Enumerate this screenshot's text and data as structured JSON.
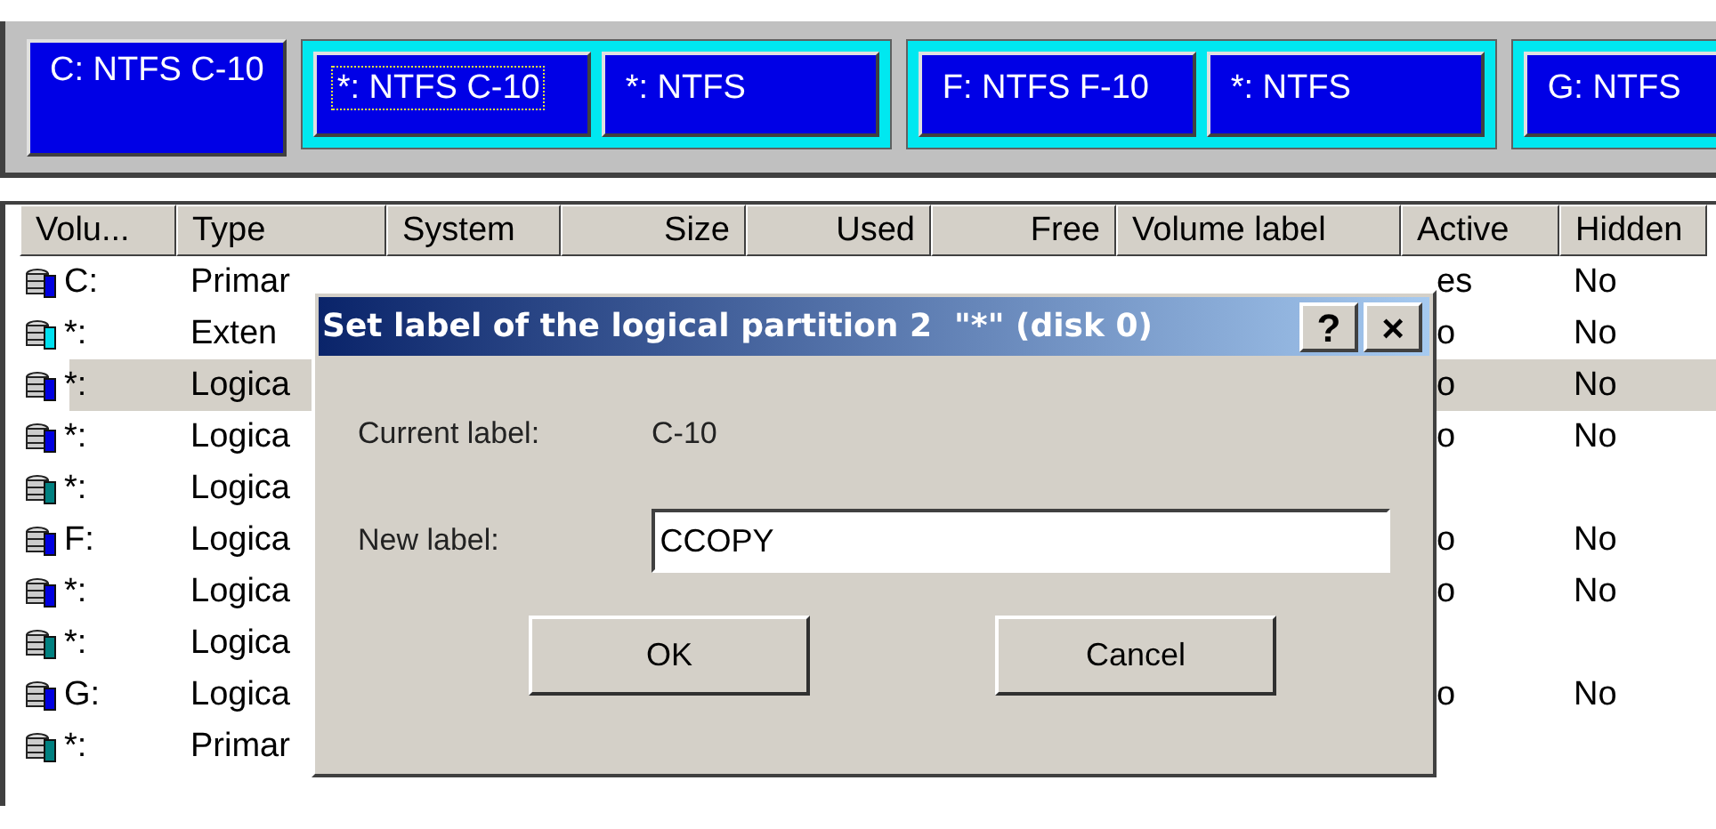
{
  "disk_map": {
    "partitions": [
      {
        "kind": "primary",
        "label": "C: NTFS C-10",
        "focused": false
      },
      {
        "kind": "extended",
        "children": [
          {
            "label": "*: NTFS C-10",
            "focused": true
          },
          {
            "label": "*: NTFS",
            "focused": false
          }
        ]
      },
      {
        "kind": "extended",
        "children": [
          {
            "label": "F: NTFS F-10",
            "focused": false
          },
          {
            "label": "*: NTFS",
            "focused": false
          }
        ]
      },
      {
        "kind": "extended",
        "children": [
          {
            "label": "G: NTFS",
            "focused": false
          }
        ]
      }
    ]
  },
  "table": {
    "columns": [
      "Volu...",
      "Type",
      "System",
      "Size",
      "Used",
      "Free",
      "Volume label",
      "Active",
      "Hidden"
    ],
    "rows": [
      {
        "volume": "C:",
        "type": "Primar",
        "active": "es",
        "hidden": "No",
        "color": "#0000e0",
        "selected": false
      },
      {
        "volume": "*:",
        "type": "Exten",
        "active": "o",
        "hidden": "No",
        "color": "#00e0f0",
        "selected": false
      },
      {
        "volume": "*:",
        "type": "Logica",
        "active": "o",
        "hidden": "No",
        "color": "#0000e0",
        "selected": true
      },
      {
        "volume": "*:",
        "type": "Logica",
        "active": "o",
        "hidden": "No",
        "color": "#0000e0",
        "selected": false
      },
      {
        "volume": "*:",
        "type": "Logica",
        "color": "#008080",
        "selected": false
      },
      {
        "volume": "F:",
        "type": "Logica",
        "active": "o",
        "hidden": "No",
        "color": "#0000e0",
        "selected": false
      },
      {
        "volume": "*:",
        "type": "Logica",
        "active": "o",
        "hidden": "No",
        "color": "#0000e0",
        "selected": false
      },
      {
        "volume": "*:",
        "type": "Logica",
        "color": "#008080",
        "selected": false
      },
      {
        "volume": "G:",
        "type": "Logica",
        "active": "o",
        "hidden": "No",
        "color": "#0000e0",
        "selected": false
      },
      {
        "volume": "*:",
        "type": "Primar",
        "color": "#008080",
        "selected": false
      }
    ]
  },
  "dialog": {
    "title": "Set label of the logical partition 2  \"*\" (disk 0)",
    "help_button": "?",
    "close_button": "×",
    "current_label_caption": "Current label:",
    "current_label": "C-10",
    "new_label_caption": "New label:",
    "new_label": "CCOPY",
    "buttons": [
      "OK",
      "Cancel"
    ]
  }
}
